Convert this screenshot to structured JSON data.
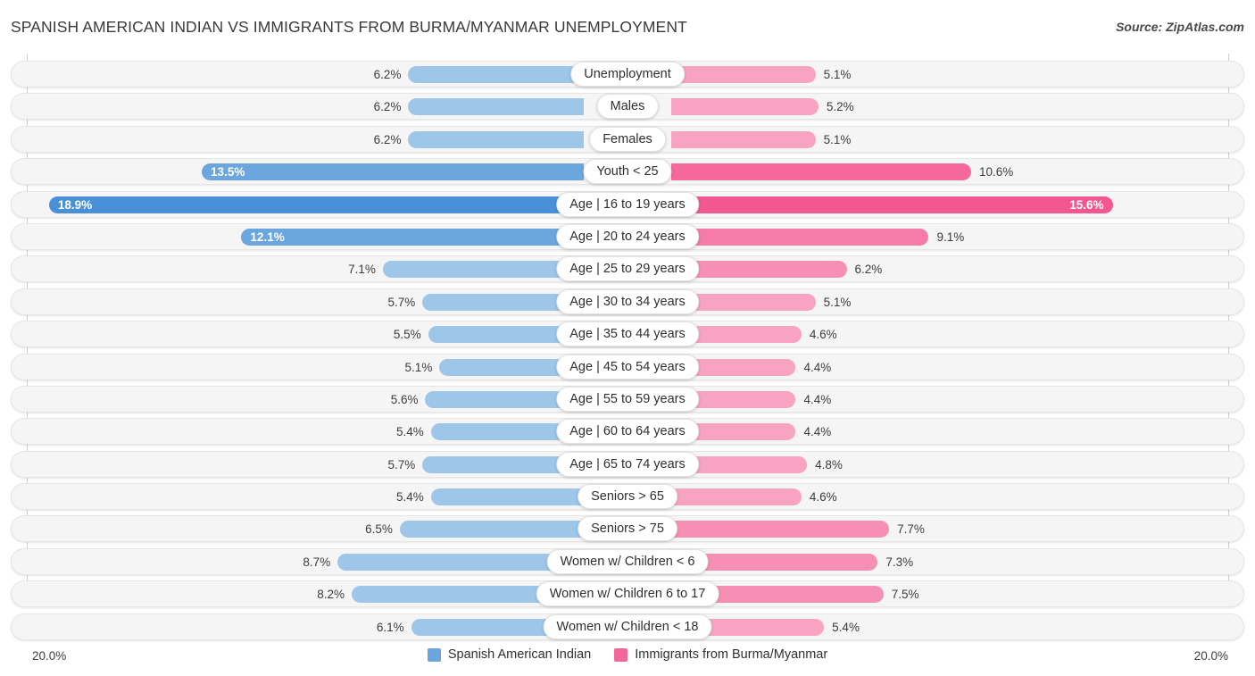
{
  "header": {
    "title": "SPANISH AMERICAN INDIAN VS IMMIGRANTS FROM BURMA/MYANMAR UNEMPLOYMENT",
    "source": "Source: ZipAtlas.com"
  },
  "axis": {
    "left_max_label": "20.0%",
    "right_max_label": "20.0%",
    "max_value": 20.0
  },
  "legend": {
    "items": [
      {
        "label": "Spanish American Indian",
        "color": "#6aa5db"
      },
      {
        "label": "Immigrants from Burma/Myanmar",
        "color": "#f2679a"
      }
    ]
  },
  "chart_data": {
    "type": "bar",
    "title": "SPANISH AMERICAN INDIAN VS IMMIGRANTS FROM BURMA/MYANMAR UNEMPLOYMENT",
    "xlabel": "",
    "ylabel": "",
    "orientation": "horizontal-diverging",
    "xlim": [
      0,
      20.0
    ],
    "grid": false,
    "legend_position": "bottom-center",
    "categories": [
      "Unemployment",
      "Males",
      "Females",
      "Youth < 25",
      "Age | 16 to 19 years",
      "Age | 20 to 24 years",
      "Age | 25 to 29 years",
      "Age | 30 to 34 years",
      "Age | 35 to 44 years",
      "Age | 45 to 54 years",
      "Age | 55 to 59 years",
      "Age | 60 to 64 years",
      "Age | 65 to 74 years",
      "Seniors > 65",
      "Seniors > 75",
      "Women w/ Children < 6",
      "Women w/ Children 6 to 17",
      "Women w/ Children < 18"
    ],
    "series": [
      {
        "name": "Spanish American Indian",
        "color": "#6aa5db",
        "values": [
          6.2,
          6.2,
          6.2,
          13.5,
          18.9,
          12.1,
          7.1,
          5.7,
          5.5,
          5.1,
          5.6,
          5.4,
          5.7,
          5.4,
          6.5,
          8.7,
          8.2,
          6.1
        ],
        "labels": [
          "6.2%",
          "6.2%",
          "6.2%",
          "13.5%",
          "18.9%",
          "12.1%",
          "7.1%",
          "5.7%",
          "5.5%",
          "5.1%",
          "5.6%",
          "5.4%",
          "5.7%",
          "5.4%",
          "6.5%",
          "8.7%",
          "8.2%",
          "6.1%"
        ]
      },
      {
        "name": "Immigrants from Burma/Myanmar",
        "color": "#f2679a",
        "values": [
          5.1,
          5.2,
          5.1,
          10.6,
          15.6,
          9.1,
          6.2,
          5.1,
          4.6,
          4.4,
          4.4,
          4.4,
          4.8,
          4.6,
          7.7,
          7.3,
          7.5,
          5.4
        ],
        "labels": [
          "5.1%",
          "5.2%",
          "5.1%",
          "10.6%",
          "15.6%",
          "9.1%",
          "6.2%",
          "5.1%",
          "4.6%",
          "4.4%",
          "4.4%",
          "4.4%",
          "4.8%",
          "4.6%",
          "7.7%",
          "7.3%",
          "7.5%",
          "5.4%"
        ]
      }
    ]
  }
}
